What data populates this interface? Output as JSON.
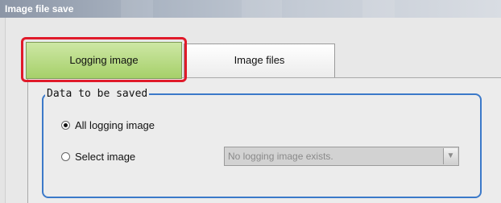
{
  "window": {
    "title": "Image file save"
  },
  "tabs": [
    {
      "label": "Logging image",
      "selected": true
    },
    {
      "label": "Image files",
      "selected": false
    }
  ],
  "data_to_be_saved": {
    "legend": "Data to be saved",
    "options": [
      {
        "label": "All logging image",
        "checked": true
      },
      {
        "label": "Select image",
        "checked": false
      }
    ],
    "select": {
      "value": "No logging image exists.",
      "disabled": true
    }
  },
  "colors": {
    "highlight": "#e01a2a",
    "active_tab": "#b7dc84",
    "group_border": "#3b79c9"
  },
  "icons": {
    "dropdown": "chevron-down-icon"
  }
}
